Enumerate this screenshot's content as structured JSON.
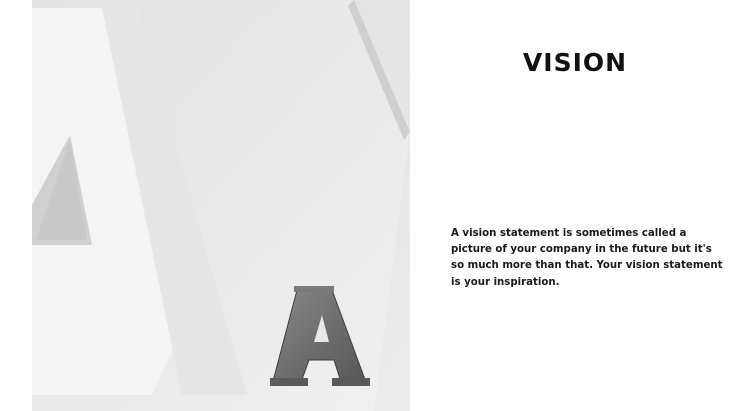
{
  "slide": {
    "title": "VISION",
    "body": "A vision statement is sometimes called a picture of your company in the future but it's so much more than that. Your vision statement is your inspiration."
  },
  "image": {
    "large_letter": "A",
    "small_letter": "A"
  }
}
